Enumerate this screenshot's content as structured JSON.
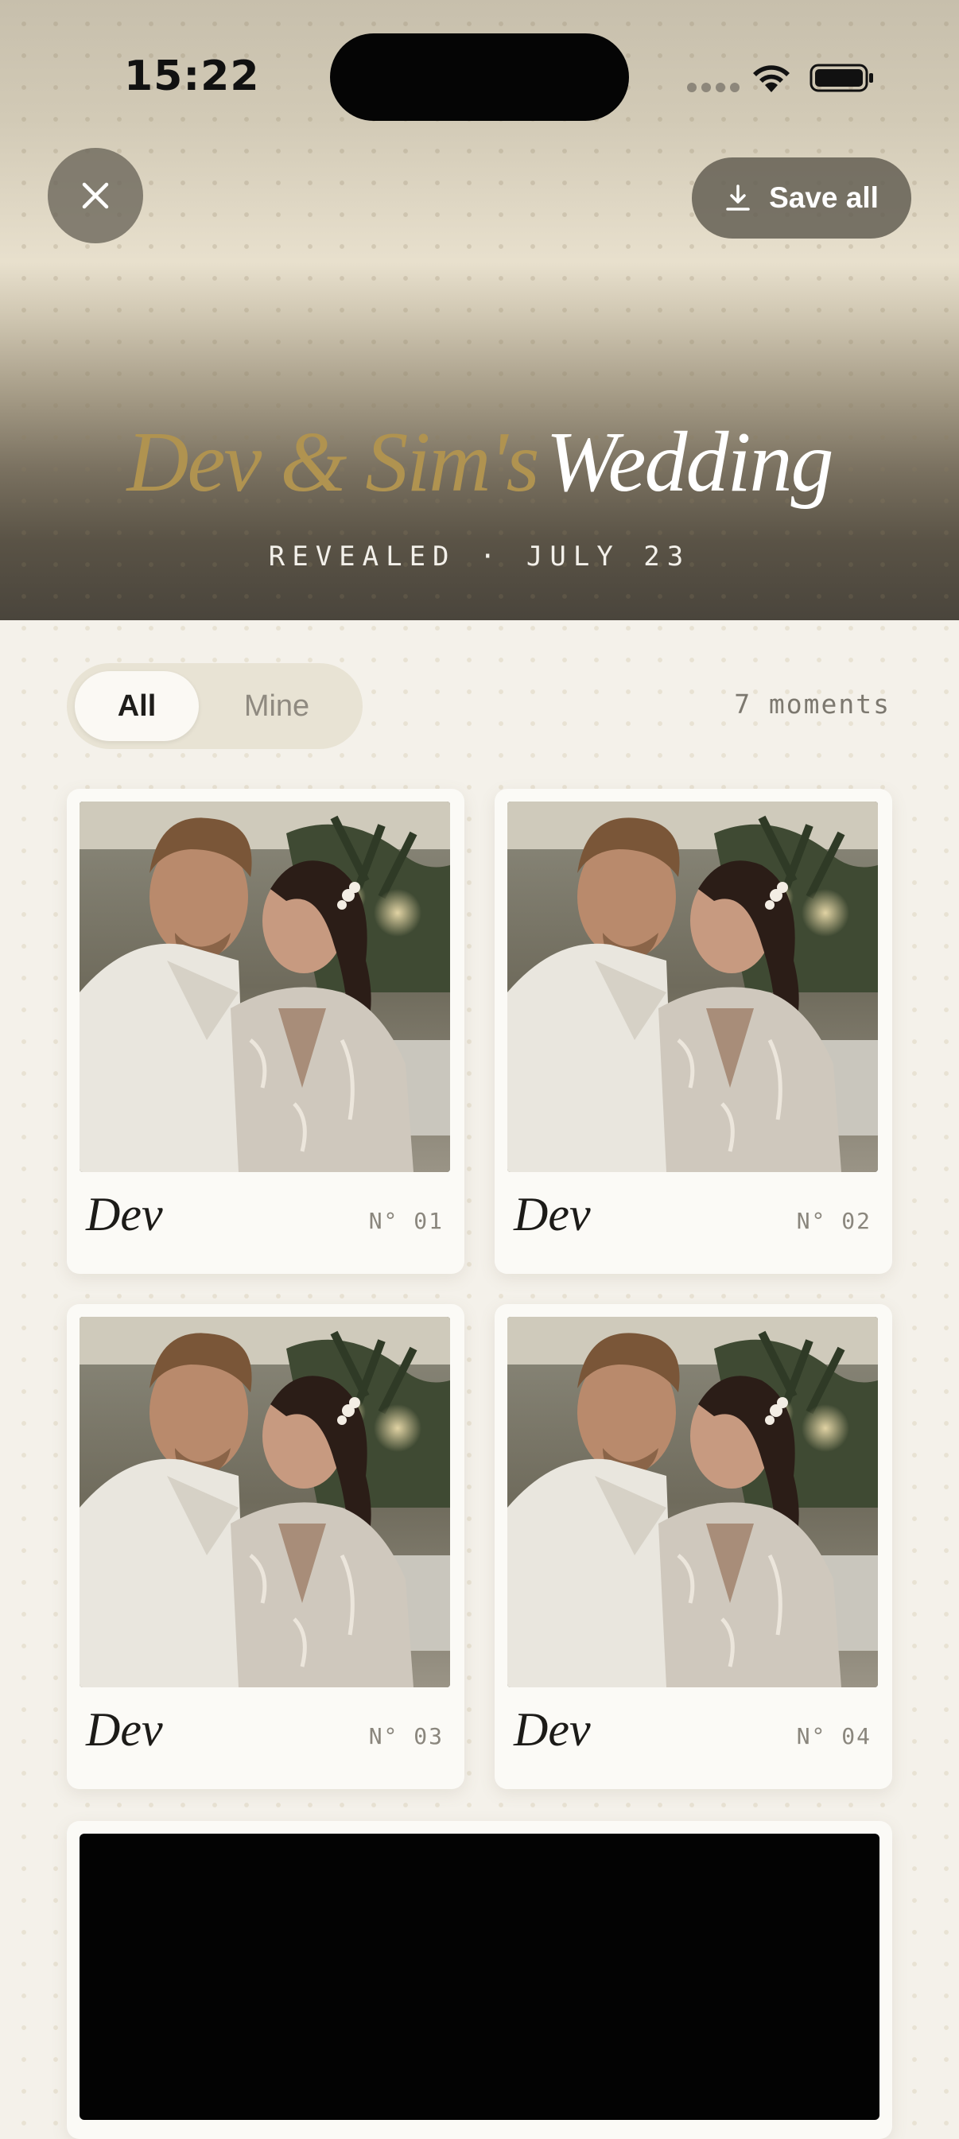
{
  "status_bar": {
    "time": "15:22"
  },
  "header": {
    "save_all_label": "Save all",
    "title_names": "Dev & Sim's",
    "title_suffix": "Wedding",
    "subtitle": "REVEALED · JULY 23"
  },
  "filter": {
    "options": [
      "All",
      "Mine"
    ],
    "selected": "All",
    "moments_count": "7 moments"
  },
  "moments": [
    {
      "author": "Dev",
      "number": "N° 01"
    },
    {
      "author": "Dev",
      "number": "N° 02"
    },
    {
      "author": "Dev",
      "number": "N° 03"
    },
    {
      "author": "Dev",
      "number": "N° 04"
    }
  ],
  "icons": {
    "close": "close-icon",
    "download": "download-icon",
    "wifi": "wifi-icon",
    "battery": "battery-icon"
  },
  "colors": {
    "accent_gold": "#b09350",
    "background": "#f4f1ea"
  }
}
